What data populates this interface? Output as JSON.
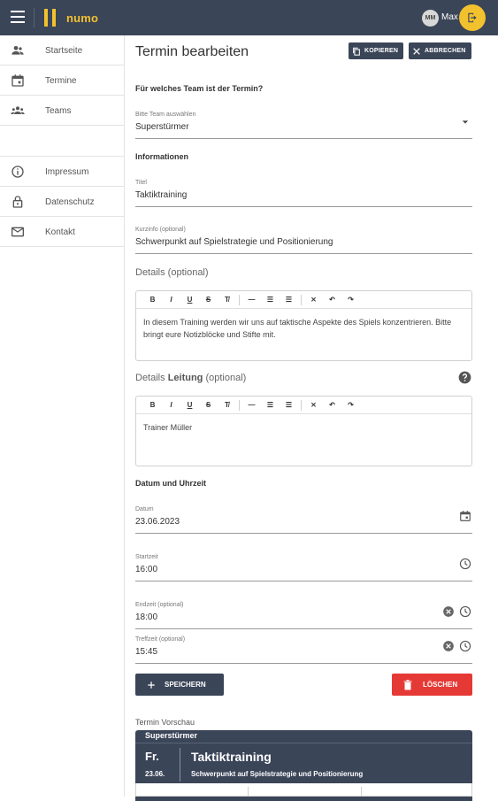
{
  "app": {
    "name": "numo"
  },
  "user": {
    "avatar_text": "MM",
    "name": "Max"
  },
  "sidebar": {
    "items": [
      {
        "label": "Startseite",
        "icon": "people-icon"
      },
      {
        "label": "Termine",
        "icon": "calendar-icon"
      },
      {
        "label": "Teams",
        "icon": "groups-icon"
      },
      {
        "label": "Impressum",
        "icon": "info-icon"
      },
      {
        "label": "Datenschutz",
        "icon": "lock-icon"
      },
      {
        "label": "Kontakt",
        "icon": "mail-icon"
      }
    ]
  },
  "page": {
    "title": "Termin bearbeiten",
    "copy_label": "KOPIEREN",
    "cancel_label": "ABBRECHEN"
  },
  "team_section": {
    "title": "Für welches Team ist der Termin?",
    "select_label": "Bitte Team auswählen",
    "select_value": "Superstürmer"
  },
  "info_section": {
    "title": "Informationen",
    "title_label": "Titel",
    "title_value": "Taktiktraining",
    "short_label": "Kurzinfo (optional)",
    "short_value": "Schwerpunkt auf Spielstrategie und Positionierung"
  },
  "details": {
    "heading": "Details (optional)",
    "body": "In diesem Training werden wir uns auf taktische Aspekte des Spiels konzentrieren. Bitte bringt eure Notizblöcke und Stifte mit."
  },
  "details_lead": {
    "heading_prefix": "Details",
    "heading_bold": "Leitung",
    "heading_suffix": "(optional)",
    "body": "Trainer Müller"
  },
  "toolbar": {
    "bold": "B",
    "italic": "I",
    "underline": "U",
    "strike": "S"
  },
  "datetime": {
    "title": "Datum und Uhrzeit",
    "date_label": "Datum",
    "date_value": "23.06.2023",
    "start_label": "Startzeit",
    "start_value": "16:00",
    "end_label": "Endzeit (optional)",
    "end_value": "18:00",
    "meet_label": "Treffzeit (optional)",
    "meet_value": "15:45"
  },
  "actions": {
    "save_label": "SPEICHERN",
    "delete_label": "LÖSCHEN"
  },
  "preview": {
    "label": "Termin Vorschau",
    "team": "Superstürmer",
    "day": "Fr.",
    "date": "23.06.",
    "title": "Taktiktraining",
    "subtitle": "Schwerpunkt auf Spielstrategie und Positionierung"
  },
  "colors": {
    "navy": "#3b4558",
    "accent": "#f2c12e",
    "danger": "#e53935"
  }
}
